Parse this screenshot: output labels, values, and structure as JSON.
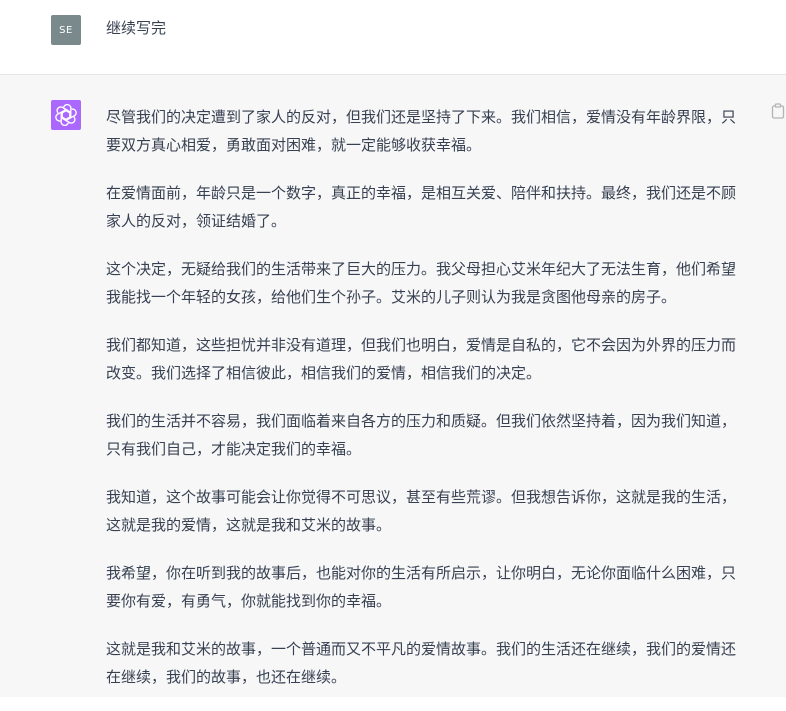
{
  "user": {
    "avatar_initials": "SE",
    "message": "继续写完"
  },
  "assistant": {
    "paragraphs": [
      "尽管我们的决定遭到了家人的反对，但我们还是坚持了下来。我们相信，爱情没有年龄界限，只要双方真心相爱，勇敢面对困难，就一定能够收获幸福。",
      "在爱情面前，年龄只是一个数字，真正的幸福，是相互关爱、陪伴和扶持。最终，我们还是不顾家人的反对，领证结婚了。",
      "这个决定，无疑给我们的生活带来了巨大的压力。我父母担心艾米年纪大了无法生育，他们希望我能找一个年轻的女孩，给他们生个孙子。艾米的儿子则认为我是贪图他母亲的房子。",
      "我们都知道，这些担忧并非没有道理，但我们也明白，爱情是自私的，它不会因为外界的压力而改变。我们选择了相信彼此，相信我们的爱情，相信我们的决定。",
      "我们的生活并不容易，我们面临着来自各方的压力和质疑。但我们依然坚持着，因为我们知道，只有我们自己，才能决定我们的幸福。",
      "我知道，这个故事可能会让你觉得不可思议，甚至有些荒谬。但我想告诉你，这就是我的生活，这就是我的爱情，这就是我和艾米的故事。",
      "我希望，你在听到我的故事后，也能对你的生活有所启示，让你明白，无论你面临什么困难，只要你有爱，有勇气，你就能找到你的幸福。",
      "这就是我和艾米的故事，一个普通而又不平凡的爱情故事。我们的生活还在继续，我们的爱情还在继续，我们的故事，也还在继续。"
    ]
  },
  "icons": {
    "assistant_logo": "openai-logo-icon",
    "copy": "clipboard-icon"
  },
  "colors": {
    "user_avatar_bg": "#7a8a8c",
    "assistant_avatar_bg": "#ab68ff",
    "assistant_row_bg": "#f7f7f8"
  }
}
